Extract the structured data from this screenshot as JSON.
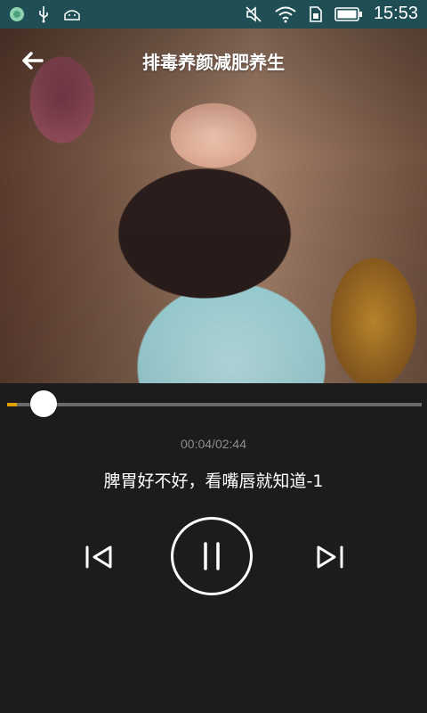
{
  "status_bar": {
    "time": "15:53",
    "icons": [
      "app-notification-icon",
      "usb-icon",
      "android-debug-icon",
      "mute-icon",
      "wifi-icon",
      "sim-icon",
      "battery-icon"
    ]
  },
  "header": {
    "title": "排毒养颜减肥养生"
  },
  "player": {
    "elapsed_total": "00:04/02:44",
    "progress_fraction": 0.024,
    "song_title": "脾胃好不好，看嘴唇就知道-1"
  },
  "colors": {
    "status_bar": "#1f4f55",
    "background": "#1c1c1c",
    "accent": "#e2a000"
  }
}
